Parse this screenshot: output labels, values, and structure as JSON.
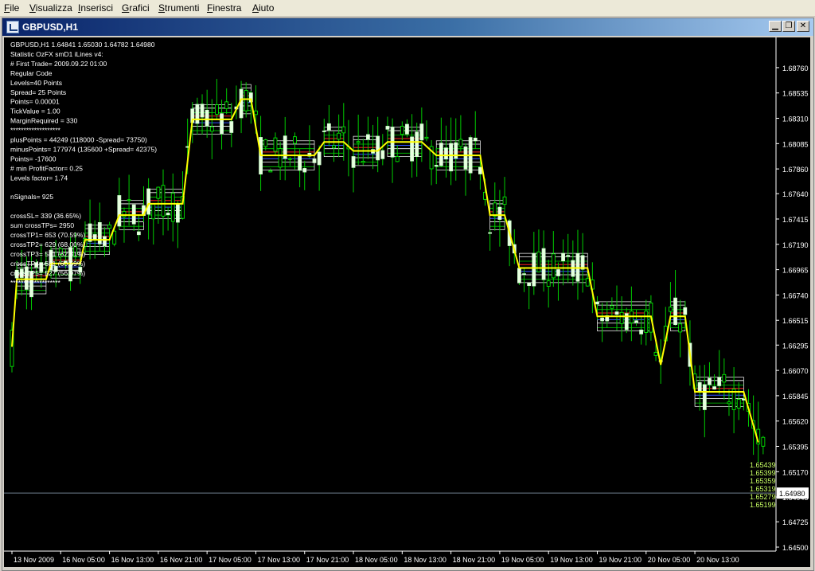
{
  "menu": [
    "File",
    "Visualizza",
    "Inserisci",
    "Grafici",
    "Strumenti",
    "Finestra",
    "Aiuto"
  ],
  "window": {
    "title": "GBPUSD,H1",
    "buttons": [
      "minimize",
      "restore",
      "close"
    ]
  },
  "chart": {
    "price_tag": "1.64980",
    "info_lines": [
      "GBPUSD,H1  1.64841 1.65030 1.64782 1.64980",
      "Statistic OzFX smD1 iLines v4:",
      "# First Trade= 2009.09.22 01:00",
      "Regular Code",
      "Levels=40 Points",
      "Spread= 25 Points",
      "Points= 0.00001",
      "TickValue  = 1.00",
      "MarginRequired  = 330",
      "*******************",
      "plusPoints  = 44249  (118000  -Spread= 73750)",
      "minusPoints= 177974  (135600  +Spread= 42375)",
      "Points= -17600",
      "# min ProfitFactor= 0.25",
      "Levels factor= 1.74",
      "",
      "nSignals= 925",
      "",
      "crossSL= 339  (36.65%)",
      "sum crossTPs= 2950",
      "crossTP1= 653   (70.59%)",
      "crossTP2= 629   (68.00%)",
      "crossTP3= 581   (62.81%)",
      "crossTP4= 581   (60.59%)",
      "crossTP5= 527   (56.97%)",
      "*******************"
    ],
    "right_level_labels": [
      "1.65439",
      "1.65399",
      "1.65359",
      "1.65319",
      "1.65279",
      "1.65199"
    ]
  },
  "chart_data": {
    "type": "candlestick",
    "symbol": "GBPUSD",
    "timeframe": "H1",
    "ylim": [
      1.645,
      1.69
    ],
    "y_ticks": [
      "1.68760",
      "1.68535",
      "1.68310",
      "1.68085",
      "1.67860",
      "1.67640",
      "1.67415",
      "1.67190",
      "1.66965",
      "1.66740",
      "1.66515",
      "1.66295",
      "1.66070",
      "1.65845",
      "1.65620",
      "1.65395",
      "1.65170",
      "1.64945",
      "1.64725",
      "1.64500"
    ],
    "x_ticks": [
      "13 Nov 2009",
      "16 Nov 05:00",
      "16 Nov 13:00",
      "16 Nov 21:00",
      "17 Nov 05:00",
      "17 Nov 13:00",
      "17 Nov 21:00",
      "18 Nov 05:00",
      "18 Nov 13:00",
      "18 Nov 21:00",
      "19 Nov 05:00",
      "19 Nov 13:00",
      "19 Nov 21:00",
      "20 Nov 05:00",
      "20 Nov 13:00"
    ],
    "current_price": 1.6498,
    "close_path": [
      [
        0,
        1.6628
      ],
      [
        1,
        1.6688
      ],
      [
        7,
        1.6688
      ],
      [
        8,
        1.6702
      ],
      [
        14,
        1.6702
      ],
      [
        15,
        1.6723
      ],
      [
        20,
        1.6723
      ],
      [
        22,
        1.6745
      ],
      [
        27,
        1.6745
      ],
      [
        28,
        1.6755
      ],
      [
        35,
        1.6755
      ],
      [
        37,
        1.683
      ],
      [
        45,
        1.683
      ],
      [
        47,
        1.6848
      ],
      [
        49,
        1.6848
      ],
      [
        51,
        1.6798
      ],
      [
        62,
        1.6798
      ],
      [
        64,
        1.681
      ],
      [
        68,
        1.681
      ],
      [
        70,
        1.6802
      ],
      [
        75,
        1.6802
      ],
      [
        77,
        1.681
      ],
      [
        84,
        1.681
      ],
      [
        87,
        1.6798
      ],
      [
        96,
        1.6798
      ],
      [
        98,
        1.6745
      ],
      [
        101,
        1.6745
      ],
      [
        104,
        1.6698
      ],
      [
        118,
        1.6698
      ],
      [
        120,
        1.6655
      ],
      [
        131,
        1.6655
      ],
      [
        133,
        1.6612
      ],
      [
        135,
        1.6655
      ],
      [
        138,
        1.6655
      ],
      [
        140,
        1.6588
      ],
      [
        150,
        1.6588
      ],
      [
        153,
        1.6543
      ]
    ]
  }
}
